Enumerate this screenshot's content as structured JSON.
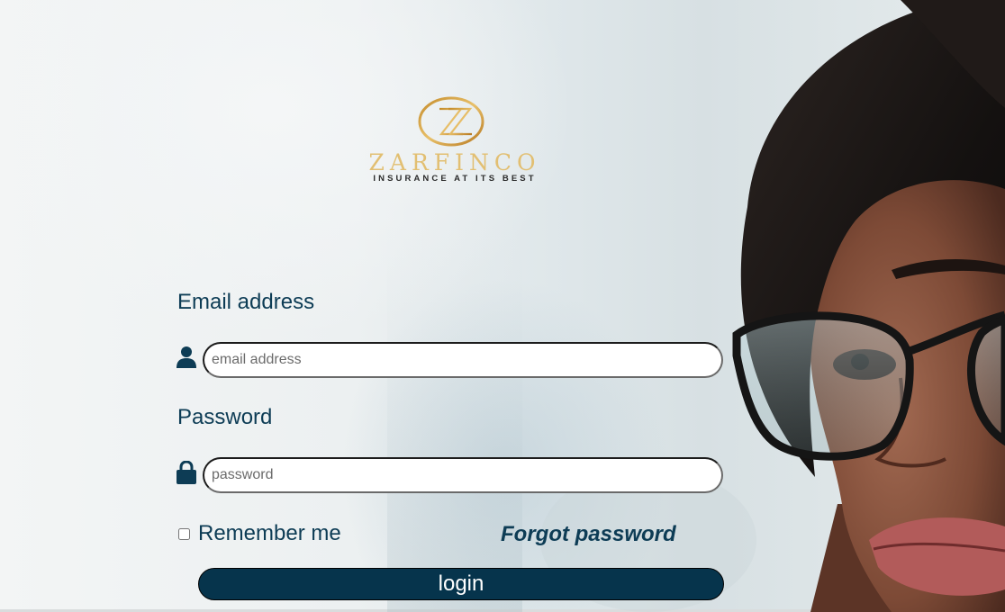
{
  "brand": {
    "name": "ZARFINCO",
    "tagline": "INSURANCE AT ITS BEST",
    "gold_color": "#e2bf72"
  },
  "form": {
    "email_label": "Email address",
    "email_placeholder": "email address",
    "email_icon": "user-icon",
    "password_label": "Password",
    "password_placeholder": "password",
    "password_icon": "lock-icon",
    "remember_label": "Remember me",
    "remember_checked": false,
    "forgot_label": "Forgot password",
    "login_label": "login"
  },
  "colors": {
    "text_primary": "#0d3c55",
    "button_bg": "#06344c"
  }
}
